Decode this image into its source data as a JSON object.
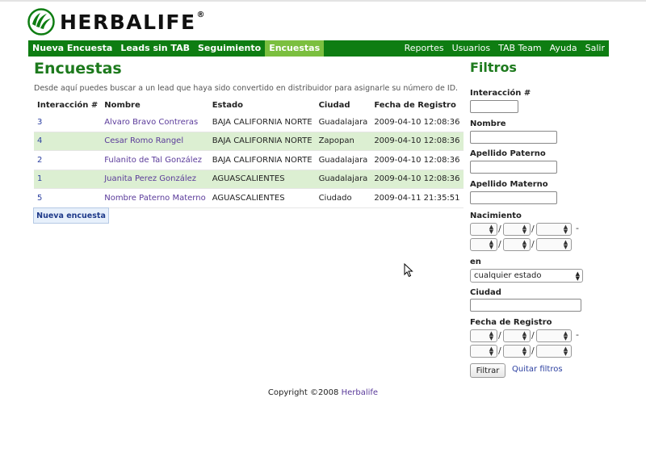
{
  "logo": {
    "text": "HERBALIFE",
    "reg": "®",
    "brand_color": "#0e7d12"
  },
  "nav": {
    "left": [
      {
        "label": "Nueva Encuesta"
      },
      {
        "label": "Leads sin TAB"
      },
      {
        "label": "Seguimiento"
      },
      {
        "label": "Encuestas",
        "active": true
      }
    ],
    "right": [
      {
        "label": "Reportes"
      },
      {
        "label": "Usuarios"
      },
      {
        "label": "TAB Team"
      },
      {
        "label": "Ayuda"
      },
      {
        "label": "Salir"
      }
    ]
  },
  "main": {
    "title": "Encuestas",
    "intro": "Desde aquí puedes buscar a un lead que haya sido convertido en distribuidor para asignarle su número de ID.",
    "columns": [
      "Interacción #",
      "Nombre",
      "Estado",
      "Ciudad",
      "Fecha de Registro"
    ],
    "rows": [
      [
        "3",
        "Alvaro Bravo Contreras",
        "BAJA CALIFORNIA NORTE",
        "Guadalajara",
        "2009-04-10 12:08:36"
      ],
      [
        "4",
        "Cesar Romo Rangel",
        "BAJA CALIFORNIA NORTE",
        "Zapopan",
        "2009-04-10 12:08:36"
      ],
      [
        "2",
        "Fulanito de Tal González",
        "BAJA CALIFORNIA NORTE",
        "Guadalajara",
        "2009-04-10 12:08:36"
      ],
      [
        "1",
        "Juanita Perez González",
        "AGUASCALIENTES",
        "Guadalajara",
        "2009-04-10 12:08:36"
      ],
      [
        "5",
        "Nombre Paterno Materno",
        "AGUASCALIENTES",
        "Ciudado",
        "2009-04-11 21:35:51"
      ]
    ],
    "new_button": "Nueva encuesta"
  },
  "filters": {
    "title": "Filtros",
    "interaccion_label": "Interacción #",
    "nombre_label": "Nombre",
    "apellido_paterno_label": "Apellido Paterno",
    "apellido_materno_label": "Apellido Materno",
    "nacimiento_label": "Nacimiento",
    "en_label": "en",
    "estado_value": "cualquier estado",
    "ciudad_label": "Ciudad",
    "fecha_label": "Fecha de Registro",
    "filtrar_button": "Filtrar",
    "quitar_link": "Quitar filtros",
    "date_sep": "/",
    "range_dash": "-"
  },
  "footer": {
    "copyright": "Copyright ©2008",
    "link": "Herbalife"
  }
}
